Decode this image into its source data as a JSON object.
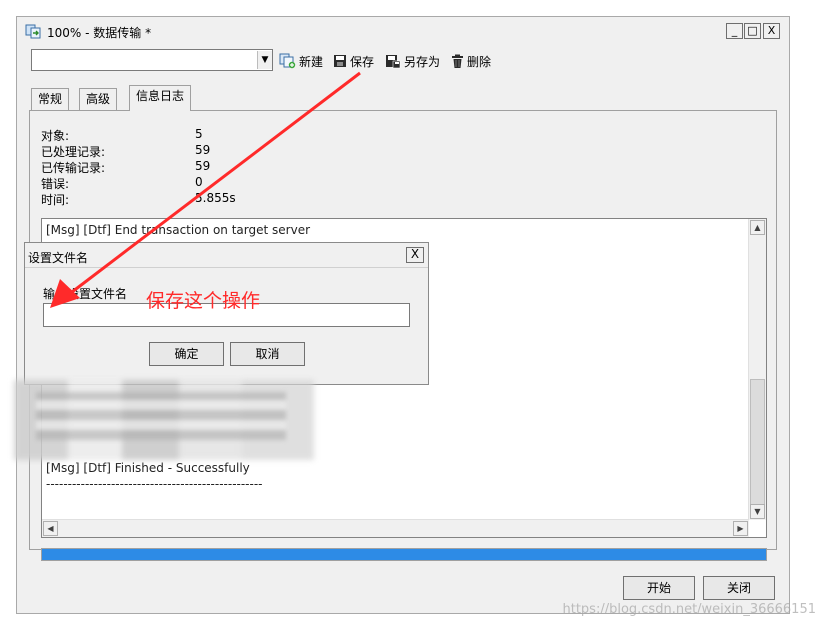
{
  "window": {
    "title": "100% - 数据传输 *",
    "caption_buttons": [
      "_",
      "□",
      "X"
    ]
  },
  "toolbar": {
    "combo_value": "",
    "new_label": "新建",
    "save_label": "保存",
    "saveas_label": "另存为",
    "delete_label": "删除"
  },
  "tabs": [
    {
      "label": "常规"
    },
    {
      "label": "高级"
    },
    {
      "label": "信息日志"
    }
  ],
  "stats": [
    {
      "label": "对象:",
      "value": "5"
    },
    {
      "label": "已处理记录:",
      "value": "59"
    },
    {
      "label": "已传输记录:",
      "value": "59"
    },
    {
      "label": "错误:",
      "value": "0"
    },
    {
      "label": "时间:",
      "value": "5.855s"
    }
  ],
  "log": {
    "lines": [
      "[Msg] [Dtf] End transaction on target server",
      "[Msg] [Dtf] Finished - Successfully",
      "--------------------------------------------------"
    ]
  },
  "progress": {
    "percent": 100,
    "color": "#2d8be6"
  },
  "bottom_buttons": {
    "start": "开始",
    "close": "关闭"
  },
  "dialog": {
    "title": "设置文件名",
    "close": "X",
    "field_label": "输入设置文件名",
    "input_value": "",
    "ok": "确定",
    "cancel": "取消"
  },
  "annotation": {
    "text": "保存这个操作",
    "color": "#ff2a2a"
  },
  "watermark": "https://blog.csdn.net/weixin_36666151"
}
